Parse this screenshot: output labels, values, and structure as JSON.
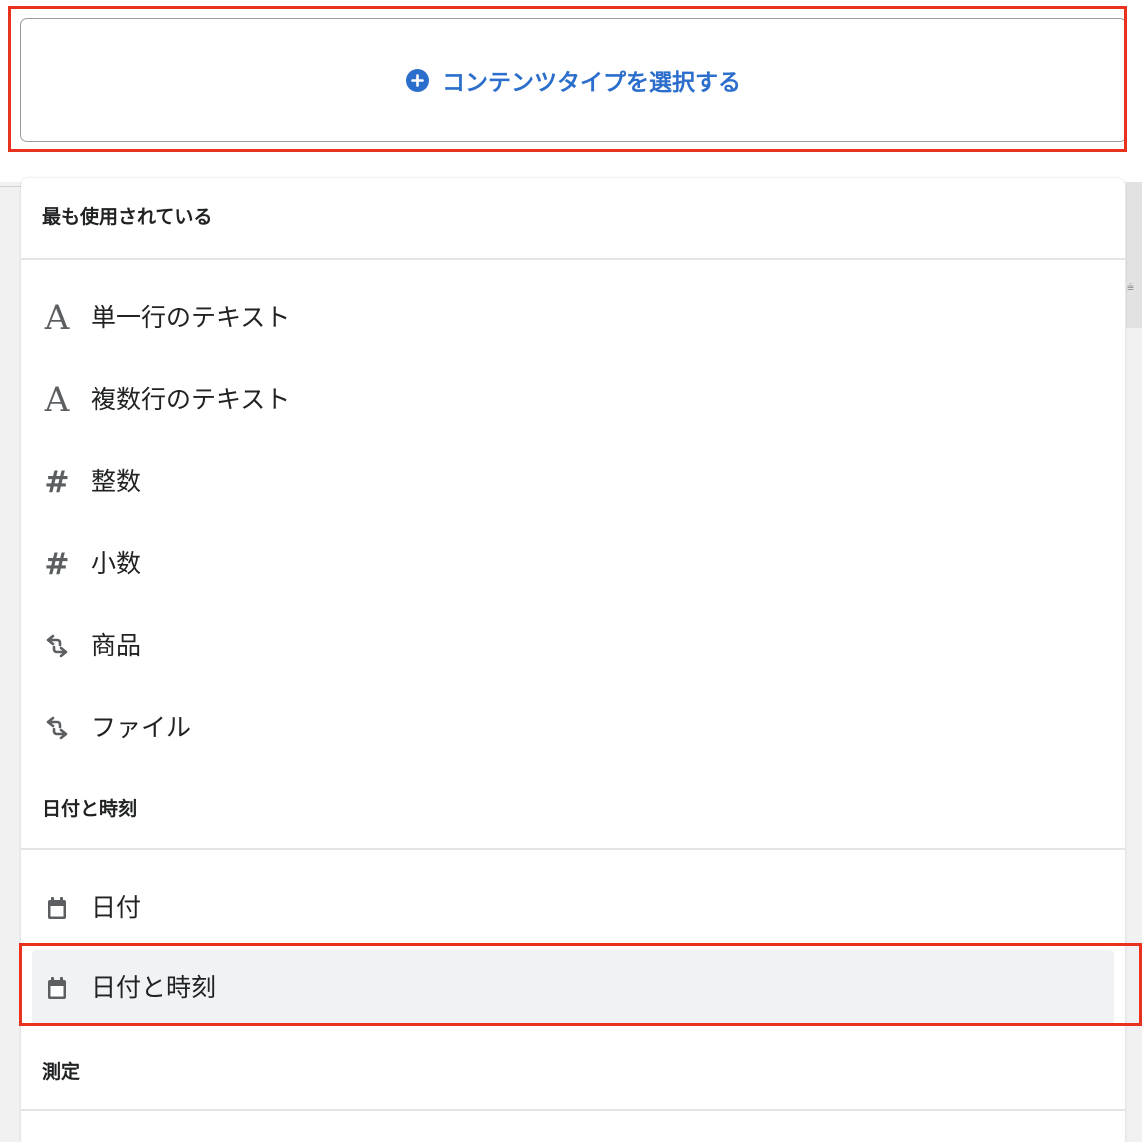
{
  "select_button": {
    "label": "コンテンツタイプを選択する",
    "icon": "plus-circle-icon"
  },
  "sections": {
    "most_used": {
      "title": "最も使用されている"
    },
    "date_time": {
      "title": "日付と時刻"
    },
    "measurement": {
      "title": "測定"
    }
  },
  "items": {
    "single_line_text": {
      "label": "単一行のテキスト",
      "icon": "text-A-icon"
    },
    "multi_line_text": {
      "label": "複数行のテキスト",
      "icon": "text-A-icon"
    },
    "integer": {
      "label": "整数",
      "icon": "hash-icon"
    },
    "decimal": {
      "label": "小数",
      "icon": "hash-icon"
    },
    "product": {
      "label": "商品",
      "icon": "reference-arrows-icon"
    },
    "file": {
      "label": "ファイル",
      "icon": "reference-arrows-icon"
    },
    "date": {
      "label": "日付",
      "icon": "calendar-icon"
    },
    "date_and_time": {
      "label": "日付と時刻",
      "icon": "calendar-icon"
    }
  },
  "colors": {
    "accent_blue": "#2c6ecb",
    "highlight_red": "#e8321e",
    "icon_gray": "#5c5f62",
    "text_dark": "#202223"
  }
}
